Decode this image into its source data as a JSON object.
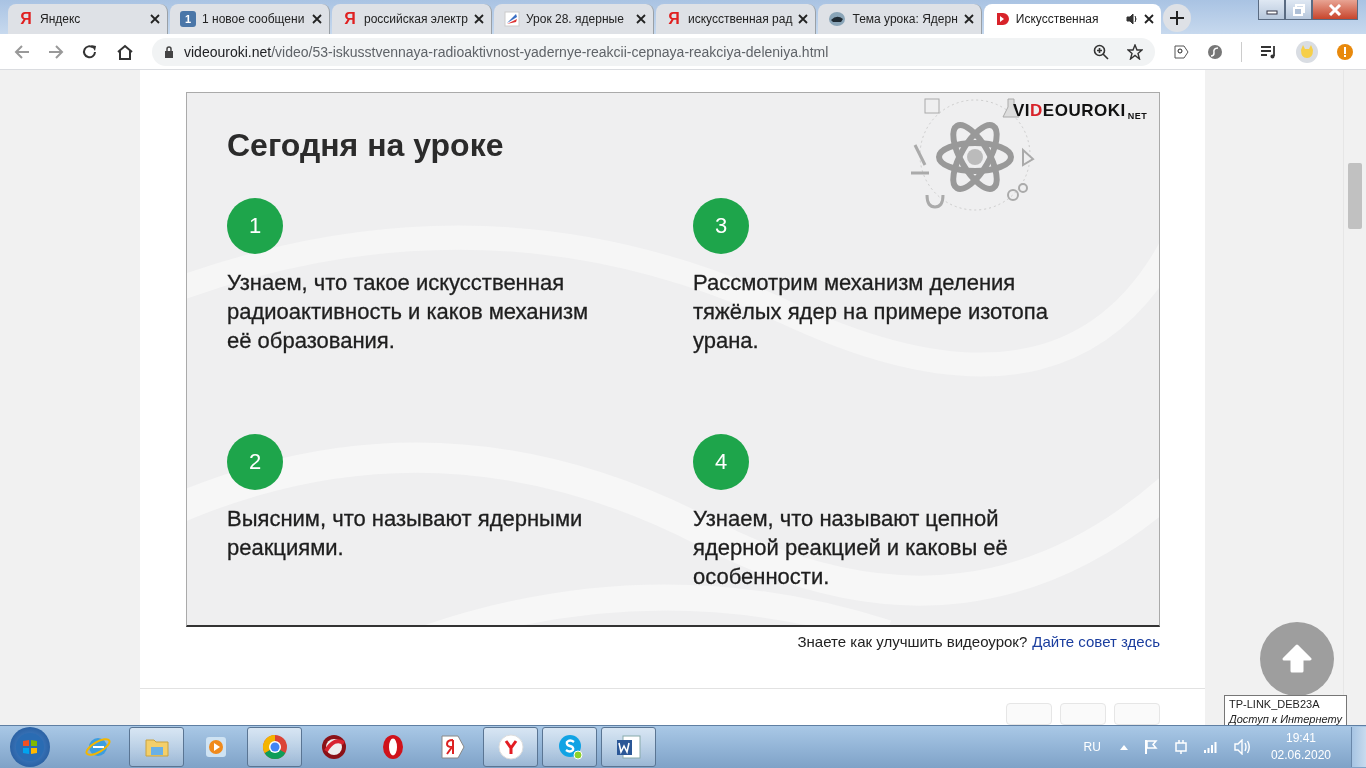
{
  "tabs": [
    {
      "kind": "yandex",
      "icon_text": "Я",
      "title": "Яндекс",
      "selected": false
    },
    {
      "kind": "badge",
      "icon_text": "1",
      "title": "1 новое сообщени",
      "selected": false
    },
    {
      "kind": "yandex",
      "icon_text": "Я",
      "title": "российская электр",
      "selected": false
    },
    {
      "kind": "lesson",
      "title": "Урок 28. ядерные",
      "selected": false
    },
    {
      "kind": "yandex",
      "icon_text": "Я",
      "title": "искусственная рад",
      "selected": false
    },
    {
      "kind": "photo",
      "title": "Тема урока: Ядерн",
      "selected": false
    },
    {
      "kind": "videouroki",
      "title": "Искусственная",
      "selected": true,
      "audio": true
    }
  ],
  "address_bar": {
    "host": "videouroki.net",
    "path": "/video/53-iskusstvennaya-radioaktivnost-yadernye-reakcii-cepnaya-reakciya-deleniya.html"
  },
  "slide": {
    "logo": {
      "parts": [
        {
          "text": "VI",
          "accent": false
        },
        {
          "text": "D",
          "accent": true
        },
        {
          "text": "EOUROKI",
          "accent": false
        }
      ],
      "suffix": "NET"
    },
    "title": "Сегодня на уроке",
    "items": [
      {
        "number": "1",
        "text": "Узнаем, что такое искусственная\nрадиоактивность и каков механизм\nеё образования."
      },
      {
        "number": "2",
        "text": "Выясним, что называют ядерными\nреакциями."
      },
      {
        "number": "3",
        "text": "Рассмотрим механизм деления\nтяжёлых ядер на примере изотопа\nурана."
      },
      {
        "number": "4",
        "text": "Узнаем, что называют цепной\nядерной реакцией и каковы её\nособенности."
      }
    ]
  },
  "feedback": {
    "text": "Знаете как улучшить видеоурок?",
    "link": "Дайте совет здесь"
  },
  "tooltip": {
    "title": "TP-LINK_DEB23A",
    "status": "Доступ к Интернету"
  },
  "taskbar": {
    "apps": [
      {
        "kind": "ie",
        "active": false
      },
      {
        "kind": "folder",
        "active": true
      },
      {
        "kind": "media",
        "active": false
      },
      {
        "kind": "chrome",
        "active": true
      },
      {
        "kind": "speed",
        "active": false
      },
      {
        "kind": "opera",
        "active": false
      },
      {
        "kind": "yandex",
        "active": false
      },
      {
        "kind": "ybrowser",
        "active": true
      },
      {
        "kind": "skype",
        "active": true
      },
      {
        "kind": "word",
        "active": true
      }
    ],
    "language": "RU",
    "time": "19:41",
    "date": "02.06.2020"
  }
}
